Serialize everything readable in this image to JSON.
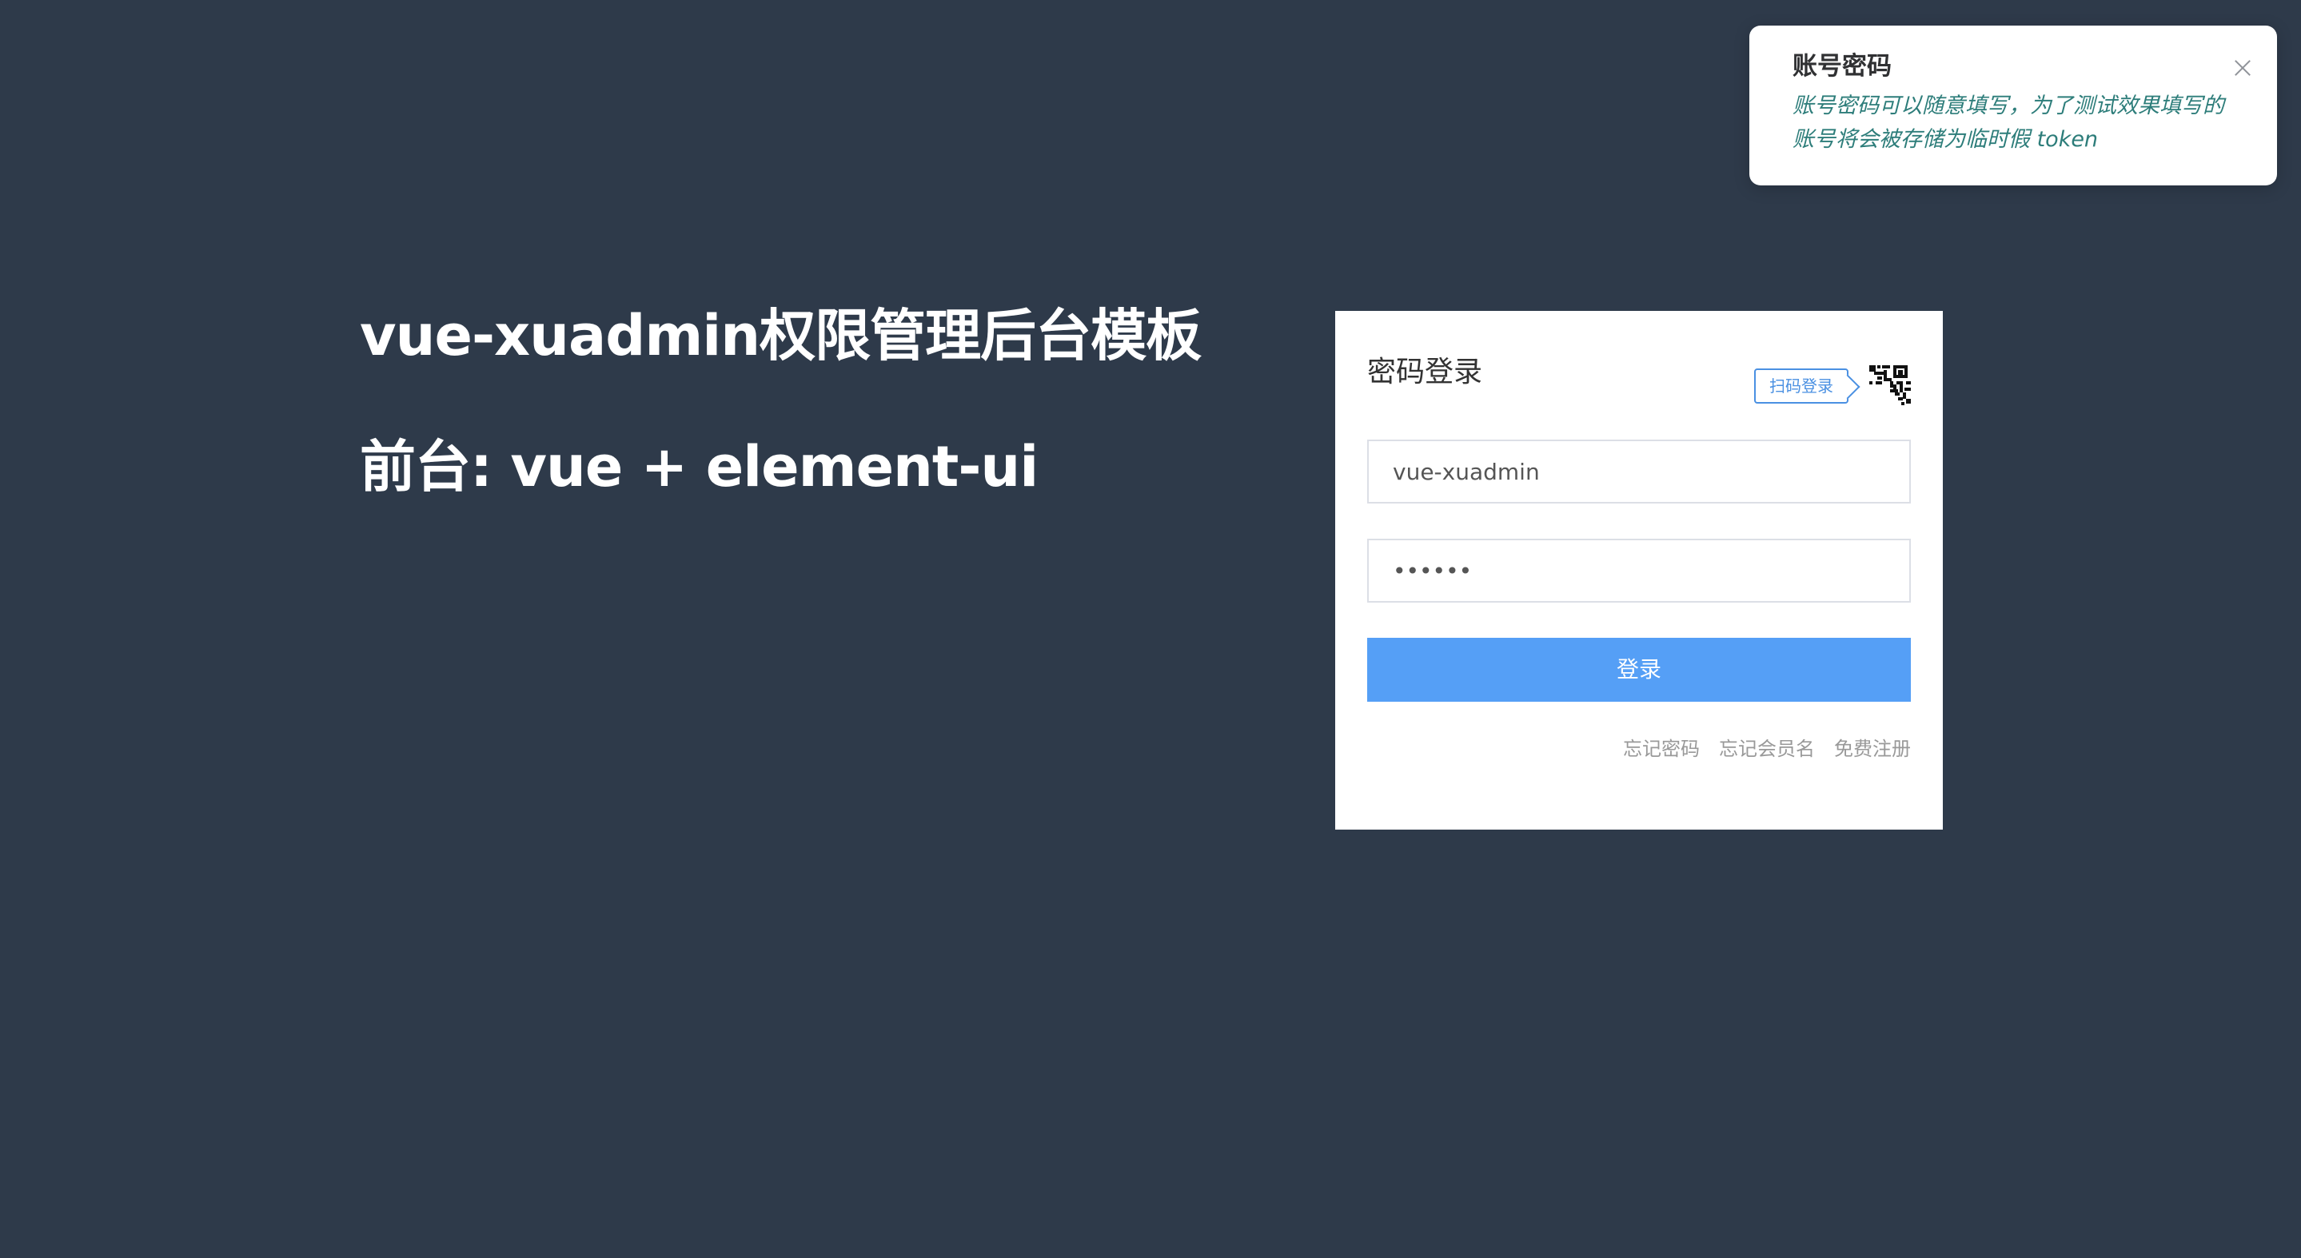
{
  "hero": {
    "title": "vue-xuadmin权限管理后台模板",
    "subtitle": "前台: vue + element-ui"
  },
  "login": {
    "title": "密码登录",
    "scan_tip": "扫码登录",
    "qr_icon": "qr-code-icon",
    "username_value": "vue-xuadmin",
    "password_value": "••••••",
    "submit_label": "登录",
    "links": {
      "forgot_password": "忘记密码",
      "forgot_username": "忘记会员名",
      "register": "免费注册"
    },
    "colors": {
      "accent": "#559ff6",
      "tip_border": "#4a90e2"
    }
  },
  "notification": {
    "title": "账号密码",
    "message": "账号密码可以随意填写，为了测试效果填写的账号将会被存储为临时假 token",
    "close_icon": "close-icon"
  },
  "colors": {
    "background": "#2e3a4a"
  }
}
